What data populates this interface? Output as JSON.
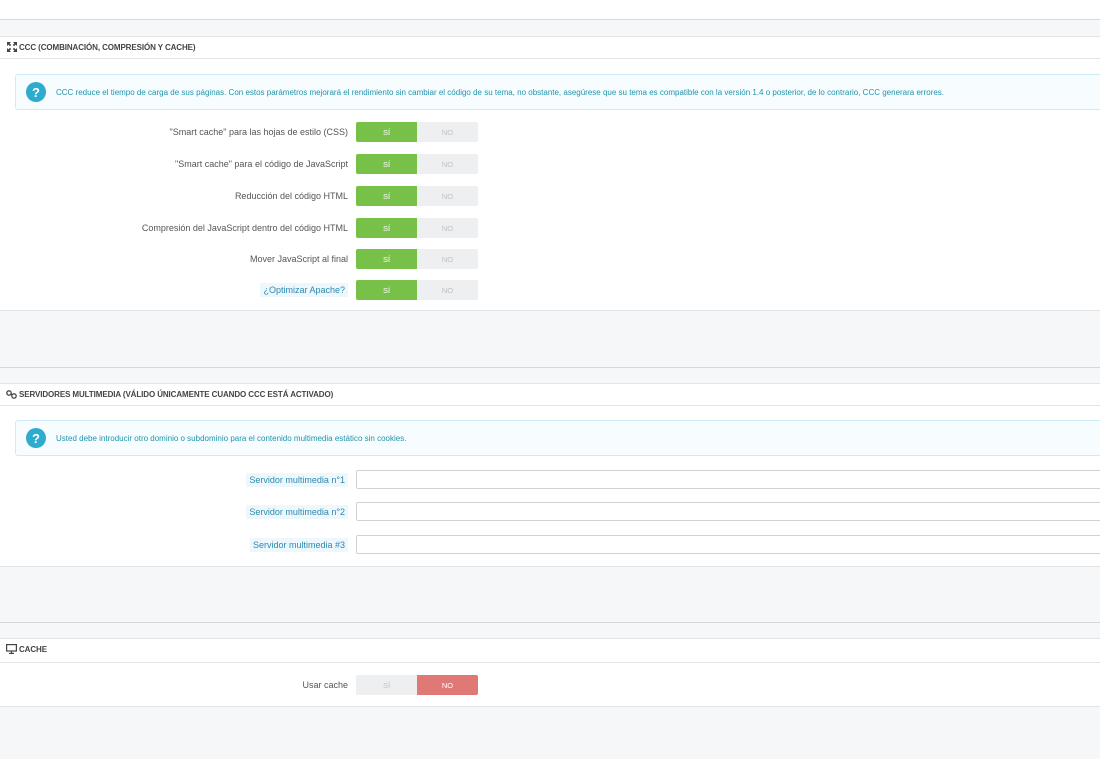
{
  "ccc": {
    "title": "CCC (COMBINACIÓN, COMPRESIÓN Y CACHE)",
    "info": "CCC reduce el tiempo de carga de sus páginas. Con estos parámetros mejorará el rendimiento sin cambiar el código de su tema, no obstante, asegúrese que su tema es compatible con la versión 1.4 o posterior, de lo contrario, CCC generara errores.",
    "rows": [
      {
        "label": "\"Smart cache\" para las hojas de estilo (CSS)",
        "yes": "SÍ",
        "no": "NO",
        "value": "yes",
        "link": false
      },
      {
        "label": "\"Smart cache\" para el código de JavaScript",
        "yes": "SÍ",
        "no": "NO",
        "value": "yes",
        "link": false
      },
      {
        "label": "Reducción del código HTML",
        "yes": "SÍ",
        "no": "NO",
        "value": "yes",
        "link": false
      },
      {
        "label": "Compresión del JavaScript dentro del código HTML",
        "yes": "SÍ",
        "no": "NO",
        "value": "yes",
        "link": false
      },
      {
        "label": "Mover JavaScript al final",
        "yes": "SÍ",
        "no": "NO",
        "value": "yes",
        "link": false
      },
      {
        "label": "¿Optimizar Apache?",
        "yes": "SÍ",
        "no": "NO",
        "value": "yes",
        "link": true
      }
    ]
  },
  "media": {
    "title": "SERVIDORES MULTIMEDIA (VÁLIDO ÚNICAMENTE CUANDO CCC ESTÁ ACTIVADO)",
    "info": "Usted debe introducir otro dominio o subdominio para el contenido multimedia estático sin cookies.",
    "fields": [
      {
        "label": "Servidor multimedia n°1",
        "value": ""
      },
      {
        "label": "Servidor multimedia n°2",
        "value": ""
      },
      {
        "label": "Servidor multimedia #3",
        "value": ""
      }
    ]
  },
  "cache": {
    "title": "CACHE",
    "row": {
      "label": "Usar cache",
      "yes": "SÍ",
      "no": "NO",
      "value": "no"
    }
  },
  "colors": {
    "yes_active": "#78c148",
    "no_active": "#e07876",
    "info_accent": "#2eacce"
  }
}
